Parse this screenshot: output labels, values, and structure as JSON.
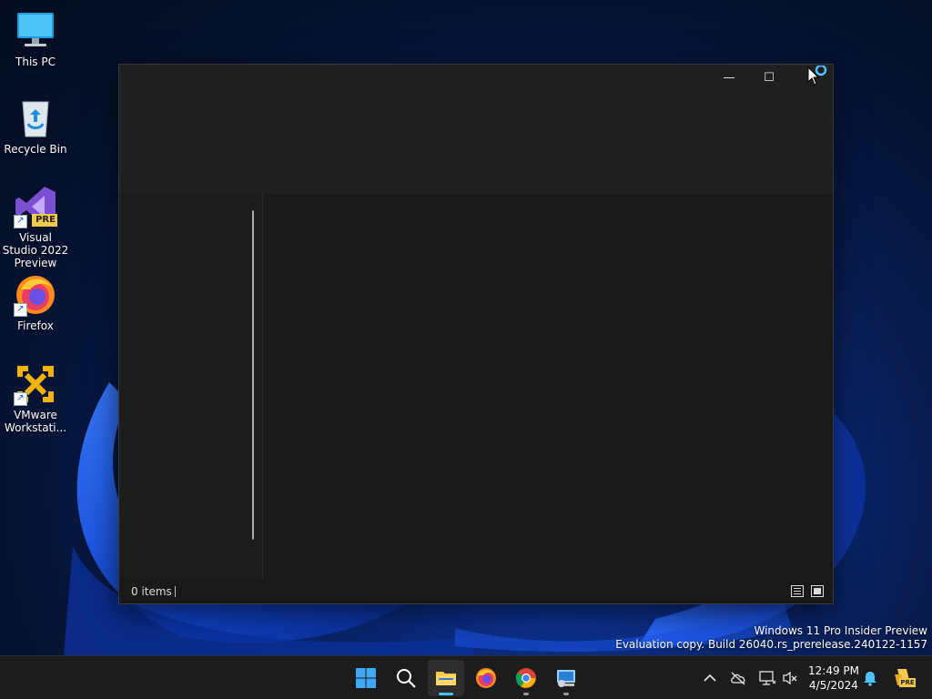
{
  "desktop": {
    "icons": [
      {
        "label": "This PC"
      },
      {
        "label": "Recycle Bin"
      },
      {
        "label": "Visual Studio 2022 Preview",
        "badge": "PRE"
      },
      {
        "label": "Firefox"
      },
      {
        "label": "VMware Workstati..."
      }
    ]
  },
  "window": {
    "caption": {
      "minimize": "—",
      "maximize": "☐",
      "close": "✕"
    },
    "statusbar": {
      "item_count": "0 items"
    }
  },
  "watermark": {
    "line1": "Windows 11 Pro Insider Preview",
    "line2": "Evaluation copy. Build 26040.rs_prerelease.240122-1157"
  },
  "taskbar": {
    "clock": {
      "time": "12:49 PM",
      "date": "4/5/2024"
    },
    "tray_badge": "PRE"
  },
  "colors": {
    "accent": "#4cc2ff",
    "taskbar_bg": "#1c1c1c",
    "window_bg": "#202020"
  }
}
